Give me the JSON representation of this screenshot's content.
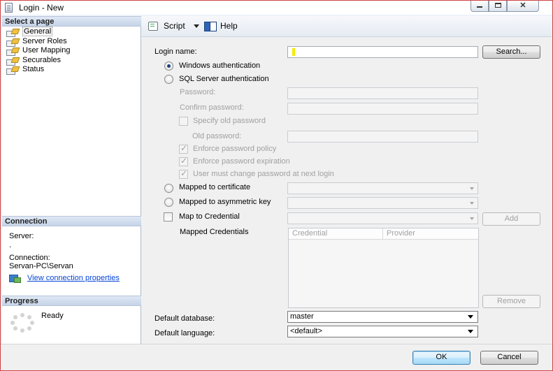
{
  "window": {
    "title": "Login - New"
  },
  "left": {
    "select_header": "Select a page",
    "pages": [
      "General",
      "Server Roles",
      "User Mapping",
      "Securables",
      "Status"
    ],
    "connection_header": "Connection",
    "server_label": "Server:",
    "server_value": ".",
    "connection_label": "Connection:",
    "connection_value": "Servan-PC\\Servan",
    "view_link": "View connection properties",
    "progress_header": "Progress",
    "progress_status": "Ready"
  },
  "toolbar": {
    "script_label": "Script",
    "help_label": "Help"
  },
  "form": {
    "login_name_label": "Login name:",
    "login_name_value": "",
    "search_button": "Search...",
    "windows_auth": "Windows authentication",
    "sql_auth": "SQL Server authentication",
    "password_label": "Password:",
    "confirm_password_label": "Confirm password:",
    "specify_old_password": "Specify old password",
    "old_password_label": "Old password:",
    "enforce_policy": "Enforce password policy",
    "enforce_expiration": "Enforce password expiration",
    "must_change": "User must change password at next login",
    "mapped_cert": "Mapped to certificate",
    "mapped_asym": "Mapped to asymmetric key",
    "map_credential": "Map to Credential",
    "add_button": "Add",
    "mapped_credentials_label": "Mapped Credentials",
    "grid_columns": [
      "Credential",
      "Provider"
    ],
    "remove_button": "Remove",
    "default_db_label": "Default database:",
    "default_db_value": "master",
    "default_lang_label": "Default language:",
    "default_lang_value": "<default>"
  },
  "footer": {
    "ok": "OK",
    "cancel": "Cancel"
  },
  "colors": {
    "link": "#0645d6",
    "disabled_text": "#a0a0a0",
    "frame_border": "#cc4444"
  }
}
